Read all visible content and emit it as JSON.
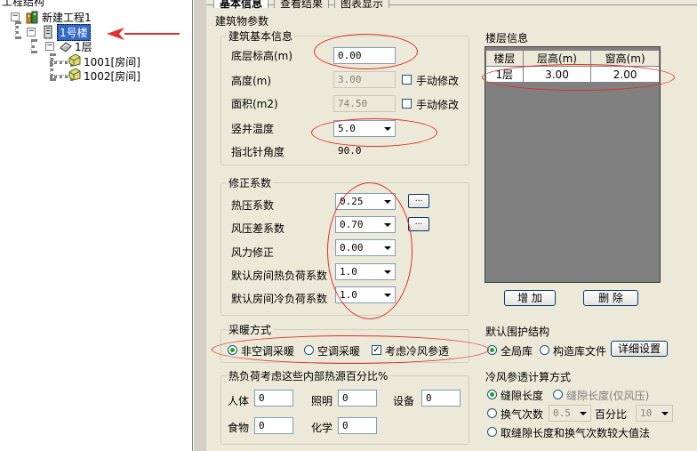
{
  "tree": {
    "title": "工程结构",
    "root": "新建工程1",
    "building": "1号楼",
    "floor": "1层",
    "rooms": [
      "1001[房间]",
      "1002[房间]"
    ]
  },
  "tabs": [
    "基本信息",
    "查看结果",
    "图表显示"
  ],
  "building_params": {
    "title": "建筑物参数",
    "basic": {
      "title": "建筑基本信息",
      "bottom_elev_label": "底层标高(m)",
      "bottom_elev": "0.00",
      "height_label": "高度(m)",
      "height": "3.00",
      "area_label": "面积(m2)",
      "area": "74.50",
      "manual_label": "手动修改",
      "shaft_temp_label": "竖井温度",
      "shaft_temp": "5.0",
      "north_angle_label": "指北针角度",
      "north_angle": "90.0"
    },
    "correction": {
      "title": "修正系数",
      "rows": [
        {
          "label": "热压系数",
          "value": "0.25"
        },
        {
          "label": "风压差系数",
          "value": "0.70"
        },
        {
          "label": "风力修正",
          "value": "0.00"
        },
        {
          "label": "默认房间热负荷系数",
          "value": "1.0"
        },
        {
          "label": "默认房间冷负荷系数",
          "value": "1.0"
        }
      ],
      "ellipsis": "..."
    },
    "heating": {
      "title": "采暖方式",
      "opt1": "非空调采暖",
      "opt2": "空调采暖",
      "opt3": "考虑冷风参透"
    },
    "heat_sources": {
      "title": "热负荷考虑这些内部热源百分比%",
      "people_label": "人体",
      "people": "0",
      "light_label": "照明",
      "light": "0",
      "equip_label": "设备",
      "equip": "0",
      "food_label": "食物",
      "food": "0",
      "chem_label": "化学",
      "chem": "0"
    }
  },
  "floor_info": {
    "title": "楼层信息",
    "headers": [
      "楼层",
      "层高(m)",
      "窗高(m)"
    ],
    "rows": [
      [
        "1层",
        "3.00",
        "2.00"
      ]
    ],
    "add_label": "增 加",
    "delete_label": "删 除"
  },
  "envelope": {
    "title": "默认围护结构",
    "opt1": "全局库",
    "opt2": "构造库文件",
    "detail_label": "详细设置"
  },
  "infiltration": {
    "title": "冷风参透计算方式",
    "opt1": "缝隙长度",
    "opt2": "缝隙长度(仅风压)",
    "opt3": "换气次数",
    "opt3_value": "0.5",
    "pct_label": "百分比",
    "pct_value": "10",
    "opt4": "取缝隙长度和换气次数较大值法"
  }
}
